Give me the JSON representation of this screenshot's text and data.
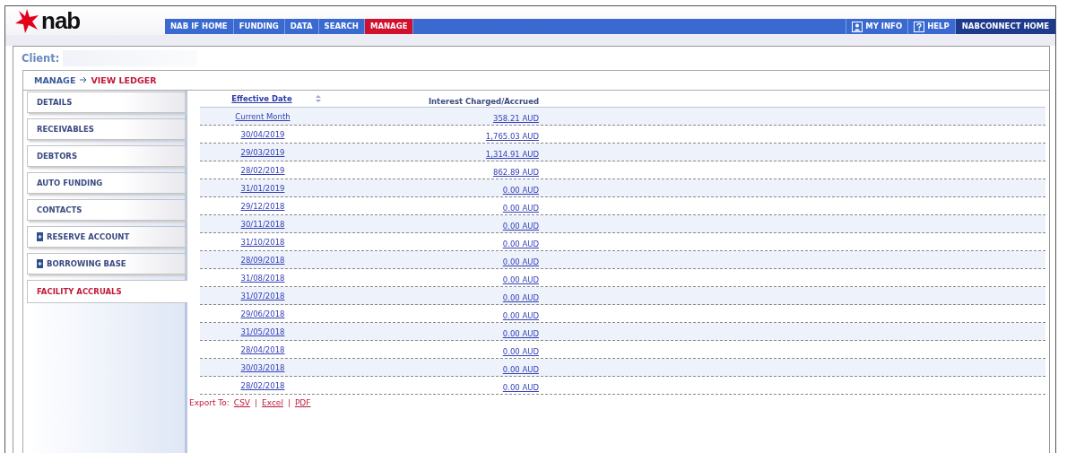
{
  "brand": {
    "name": "nab"
  },
  "nav": {
    "left": [
      {
        "label": "NAB IF HOME",
        "selected": false
      },
      {
        "label": "FUNDING",
        "selected": false
      },
      {
        "label": "DATA",
        "selected": false
      },
      {
        "label": "SEARCH",
        "selected": false
      },
      {
        "label": "MANAGE",
        "selected": true
      }
    ],
    "right": [
      {
        "label": "MY INFO",
        "kind": "person"
      },
      {
        "label": "HELP",
        "kind": "help"
      },
      {
        "label": "NABCONNECT HOME",
        "kind": "home"
      }
    ]
  },
  "client_label": "Client:",
  "breadcrumb": {
    "parent": "MANAGE",
    "current": "VIEW LEDGER"
  },
  "sidebar": {
    "items": [
      {
        "label": "DETAILS",
        "expandable": false,
        "selected": false
      },
      {
        "label": "RECEIVABLES",
        "expandable": false,
        "selected": false
      },
      {
        "label": "DEBTORS",
        "expandable": false,
        "selected": false
      },
      {
        "label": "AUTO FUNDING",
        "expandable": false,
        "selected": false
      },
      {
        "label": "CONTACTS",
        "expandable": false,
        "selected": false
      },
      {
        "label": "RESERVE ACCOUNT",
        "expandable": true,
        "selected": false
      },
      {
        "label": "BORROWING BASE",
        "expandable": true,
        "selected": false
      },
      {
        "label": "FACILITY ACCRUALS",
        "expandable": false,
        "selected": true
      }
    ]
  },
  "table": {
    "columns": [
      {
        "label": "Effective Date",
        "sortable": true
      },
      {
        "label": "Interest Charged/Accrued",
        "sortable": false
      }
    ],
    "rows": [
      {
        "date": "Current Month",
        "amount": "358.21 AUD"
      },
      {
        "date": "30/04/2019",
        "amount": "1,765.03 AUD"
      },
      {
        "date": "29/03/2019",
        "amount": "1,314.91 AUD"
      },
      {
        "date": "28/02/2019",
        "amount": "862.89 AUD"
      },
      {
        "date": "31/01/2019",
        "amount": "0.00 AUD"
      },
      {
        "date": "29/12/2018",
        "amount": "0.00 AUD"
      },
      {
        "date": "30/11/2018",
        "amount": "0.00 AUD"
      },
      {
        "date": "31/10/2018",
        "amount": "0.00 AUD"
      },
      {
        "date": "28/09/2018",
        "amount": "0.00 AUD"
      },
      {
        "date": "31/08/2018",
        "amount": "0.00 AUD"
      },
      {
        "date": "31/07/2018",
        "amount": "0.00 AUD"
      },
      {
        "date": "29/06/2018",
        "amount": "0.00 AUD"
      },
      {
        "date": "31/05/2018",
        "amount": "0.00 AUD"
      },
      {
        "date": "28/04/2018",
        "amount": "0.00 AUD"
      },
      {
        "date": "30/03/2018",
        "amount": "0.00 AUD"
      },
      {
        "date": "28/02/2018",
        "amount": "0.00 AUD"
      }
    ]
  },
  "export": {
    "label": "Export To:",
    "separator": "|",
    "links": [
      "CSV",
      "Excel",
      "PDF"
    ]
  }
}
